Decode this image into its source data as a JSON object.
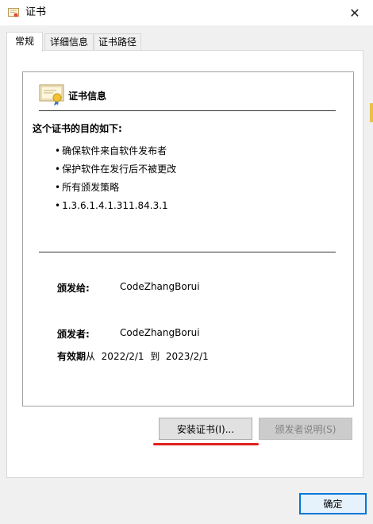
{
  "window": {
    "title": "证书",
    "close_glyph": "✕",
    "title_icon": "certificate-icon"
  },
  "tabs": [
    {
      "label": "常规",
      "active": true
    },
    {
      "label": "详细信息",
      "active": false
    },
    {
      "label": "证书路径",
      "active": false
    }
  ],
  "cert": {
    "icon": "certificate-icon",
    "title": "证书信息",
    "purpose_title": "这个证书的目的如下:",
    "purposes": [
      "确保软件来自软件发布者",
      "保护软件在发行后不被更改",
      "所有颁发策略",
      "1.3.6.1.4.1.311.84.3.1"
    ],
    "issued_to_label": "颁发给:",
    "issued_to_value": "CodeZhangBorui",
    "issued_by_label": "颁发者:",
    "issued_by_value": "CodeZhangBorui",
    "validity_label": "有效期",
    "validity_from_word": "从",
    "valid_from": "2022/2/1",
    "validity_to_word": "到",
    "valid_to": "2023/2/1"
  },
  "buttons": {
    "install": "安装证书(I)...",
    "issuer_statement": "颁发者说明(S)",
    "ok": "确定"
  },
  "colors": {
    "highlight_underline": "#e0201c",
    "default_button_border": "#0078d7"
  }
}
